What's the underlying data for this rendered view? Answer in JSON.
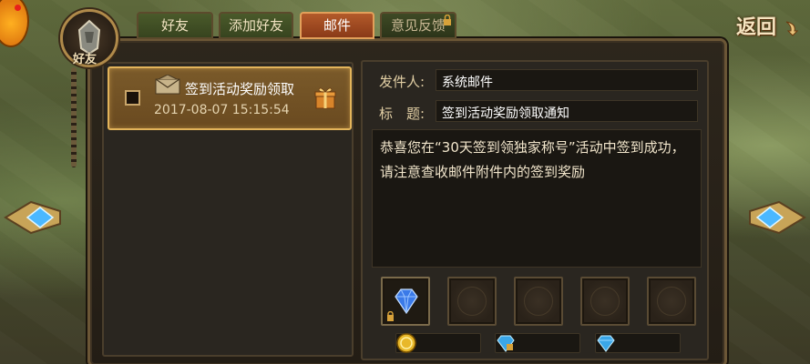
{
  "tabs": [
    {
      "label": "好友"
    },
    {
      "label": "添加好友"
    },
    {
      "label": "邮件"
    },
    {
      "label": "意见反馈"
    }
  ],
  "emblem_label": "好友",
  "back_label": "返回",
  "mail_list": {
    "items": [
      {
        "title": "签到活动奖励领取",
        "time": "2017-08-07 15:15:54",
        "has_gift": true
      }
    ]
  },
  "detail": {
    "sender_label": "发件人:",
    "sender_value": "系统邮件",
    "subject_label": "标　题:",
    "subject_value": "签到活动奖励领取通知",
    "body": "恭喜您在“30天签到领独家称号”活动中签到成功，请注意查收邮件附件内的签到奖励"
  },
  "attachments": {
    "slots": [
      {
        "icon": "blue-diamond-icon",
        "locked": true
      },
      {
        "icon": "empty"
      },
      {
        "icon": "empty"
      },
      {
        "icon": "empty"
      },
      {
        "icon": "empty"
      }
    ],
    "currencies": [
      {
        "icon": "gold-coin-icon",
        "value": ""
      },
      {
        "icon": "bound-diamond-icon",
        "value": ""
      },
      {
        "icon": "diamond-icon",
        "value": ""
      }
    ]
  },
  "colors": {
    "accent": "#e3b45a",
    "active_tab": "#b35a2a",
    "panel": "#2a2620"
  }
}
